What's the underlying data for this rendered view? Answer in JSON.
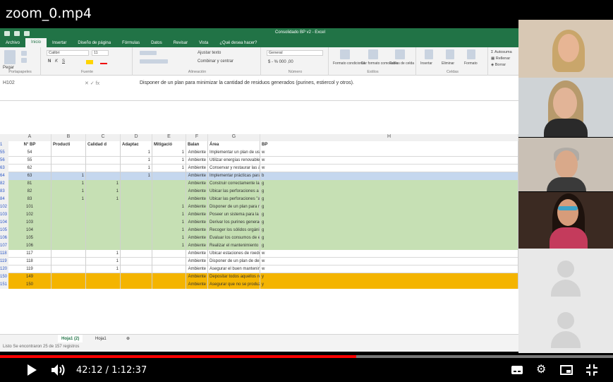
{
  "video": {
    "title": "zoom_0.mp4",
    "time": "42:12 / 1:12:37",
    "progress": 0.581
  },
  "excel": {
    "window_title": "Consolidado BP v2 - Excel",
    "menu": [
      "Archivo",
      "Inicio",
      "Insertar",
      "Diseño de página",
      "Fórmulas",
      "Datos",
      "Revisar",
      "Vista",
      "¿Qué desea hacer?"
    ],
    "ribbon": {
      "font_name": "Calibri",
      "font_size": "11",
      "format": "General",
      "groups": [
        "Portapapeles",
        "Fuente",
        "Alineación",
        "Número",
        "Estilos",
        "Celdas"
      ],
      "buttons": [
        "Pegar",
        "Ajustar texto",
        "Combinar y centrar",
        "Formato condicional",
        "Dar formato como tabla",
        "Estilos de celda",
        "Insertar",
        "Eliminar",
        "Formato",
        "Autosuma",
        "Rellenar",
        "Borrar"
      ]
    },
    "name_box": "H102",
    "formula": "Disponer de un plan para minimizar la cantidad de residuos generados (purines, estiercol y otros).",
    "col_letters": [
      "A",
      "B",
      "C",
      "D",
      "E",
      "F",
      "G",
      "H"
    ],
    "headers": [
      "N° BP",
      "Producti",
      "Calidad d",
      "Adaptac",
      "Mitigació",
      "Balan",
      "Área",
      "BP"
    ],
    "rows": [
      [
        "55",
        "54",
        "",
        "",
        "1",
        "1",
        "Ambiente",
        "Implementar un plan de uso y manejo eficiente del agua que incorpore estas prácticas: dism",
        "w"
      ],
      [
        "56",
        "55",
        "",
        "",
        "1",
        "1",
        "Ambiente",
        "Utilizar energías renovables (energía solar, eólica, biocombustibles, biogás) cuando puedan",
        "w"
      ],
      [
        "63",
        "62",
        "",
        "",
        "1",
        "1",
        "Ambiente",
        "Conservar y restaurar las áreas naturales.",
        "w"
      ],
      [
        "64",
        "63",
        "1",
        "",
        "1",
        "",
        "Ambiente",
        "Implementar prácticas para recolección o cosecha y de almacenamiento el agua de lluvia de",
        "b"
      ],
      [
        "82",
        "81",
        "1",
        "1",
        "",
        "",
        "Ambiente",
        "Construir correctamente las perforaciones: encamisadas, con los filtros necesarios y la boca c",
        "g"
      ],
      [
        "83",
        "82",
        "1",
        "1",
        "",
        "",
        "Ambiente",
        "Ubicar las perforaciones a una distancia prudencial (entre 50 y 100 m) de cámaras sépticas o l",
        "g"
      ],
      [
        "84",
        "83",
        "1",
        "1",
        "",
        "",
        "Ambiente",
        "Ubicar las perforaciones \"aguas arriba\" de las fuentes de contaminación del agua subterráne",
        "g"
      ],
      [
        "102",
        "101",
        "",
        "",
        "",
        "1",
        "Ambiente",
        "Disponer de un plan para minimizar la cantidad de residuos generados (purines, estiercol y o",
        "g"
      ],
      [
        "103",
        "102",
        "",
        "",
        "",
        "1",
        "Ambiente",
        "Poseer un sistema para la gestión de los purines, que los contengan (fosas, lagunas, biodiges",
        "g"
      ],
      [
        "104",
        "103",
        "",
        "",
        "",
        "1",
        "Ambiente",
        "Derivar los purines generados mediante entubamiento o canal de concreto (pudiendo existir",
        "g"
      ],
      [
        "105",
        "104",
        "",
        "",
        "",
        "1",
        "Ambiente",
        "Recoger los sólidos orgánicos (estiércol y restos de alimentos) que quedan depositados en lo",
        "g"
      ],
      [
        "106",
        "105",
        "",
        "",
        "",
        "1",
        "Ambiente",
        "Evaluar los consumos de energía del establecimiento e implementar al menos una opción pa",
        "g"
      ],
      [
        "107",
        "106",
        "",
        "",
        "",
        "1",
        "Ambiente",
        "Realizar el mantenimiento y chequeos de equipos y maquinaria tendientes a eficientizar su c",
        "g"
      ],
      [
        "118",
        "117",
        "",
        "1",
        "",
        "",
        "Ambiente",
        "Ubicar estaciones de roedores alrededor de las instalaciones y registrar el consumo del cebo",
        "w"
      ],
      [
        "119",
        "118",
        "",
        "1",
        "",
        "",
        "Ambiente",
        "Disponer de un plan de desinsectación, a realizarse fuera de los horarios de ordeño y limpiez",
        "w"
      ],
      [
        "120",
        "119",
        "",
        "1",
        "",
        "",
        "Ambiente",
        "Asegurar el buen mantenimiento y la limpieza de las instalaciones, recolectando basura, evit",
        "w"
      ],
      [
        "150",
        "149",
        "",
        "",
        "",
        "",
        "Ambiente",
        "Depositar todos aquellos residuos sólidos inorgánicos generados en las instalaciones de ordeñ",
        "y"
      ],
      [
        "151",
        "150",
        "",
        "",
        "",
        "",
        "Ambiente",
        "Asegurar que no se produzcan pérdidas por infiltración o lixiviación desde los lotes de los sectores d",
        "y"
      ]
    ],
    "sheet_tabs": [
      "Hoja1 (2)",
      "Hoja1"
    ],
    "status": "Listo   Se encontraron 25 de 157 registros"
  },
  "colors": {
    "excel_green": "#217346",
    "row_green": "#c6e0b4",
    "row_yellow": "#f4b400",
    "row_blue": "#c5d7ee",
    "progress_red": "#ff0000"
  }
}
